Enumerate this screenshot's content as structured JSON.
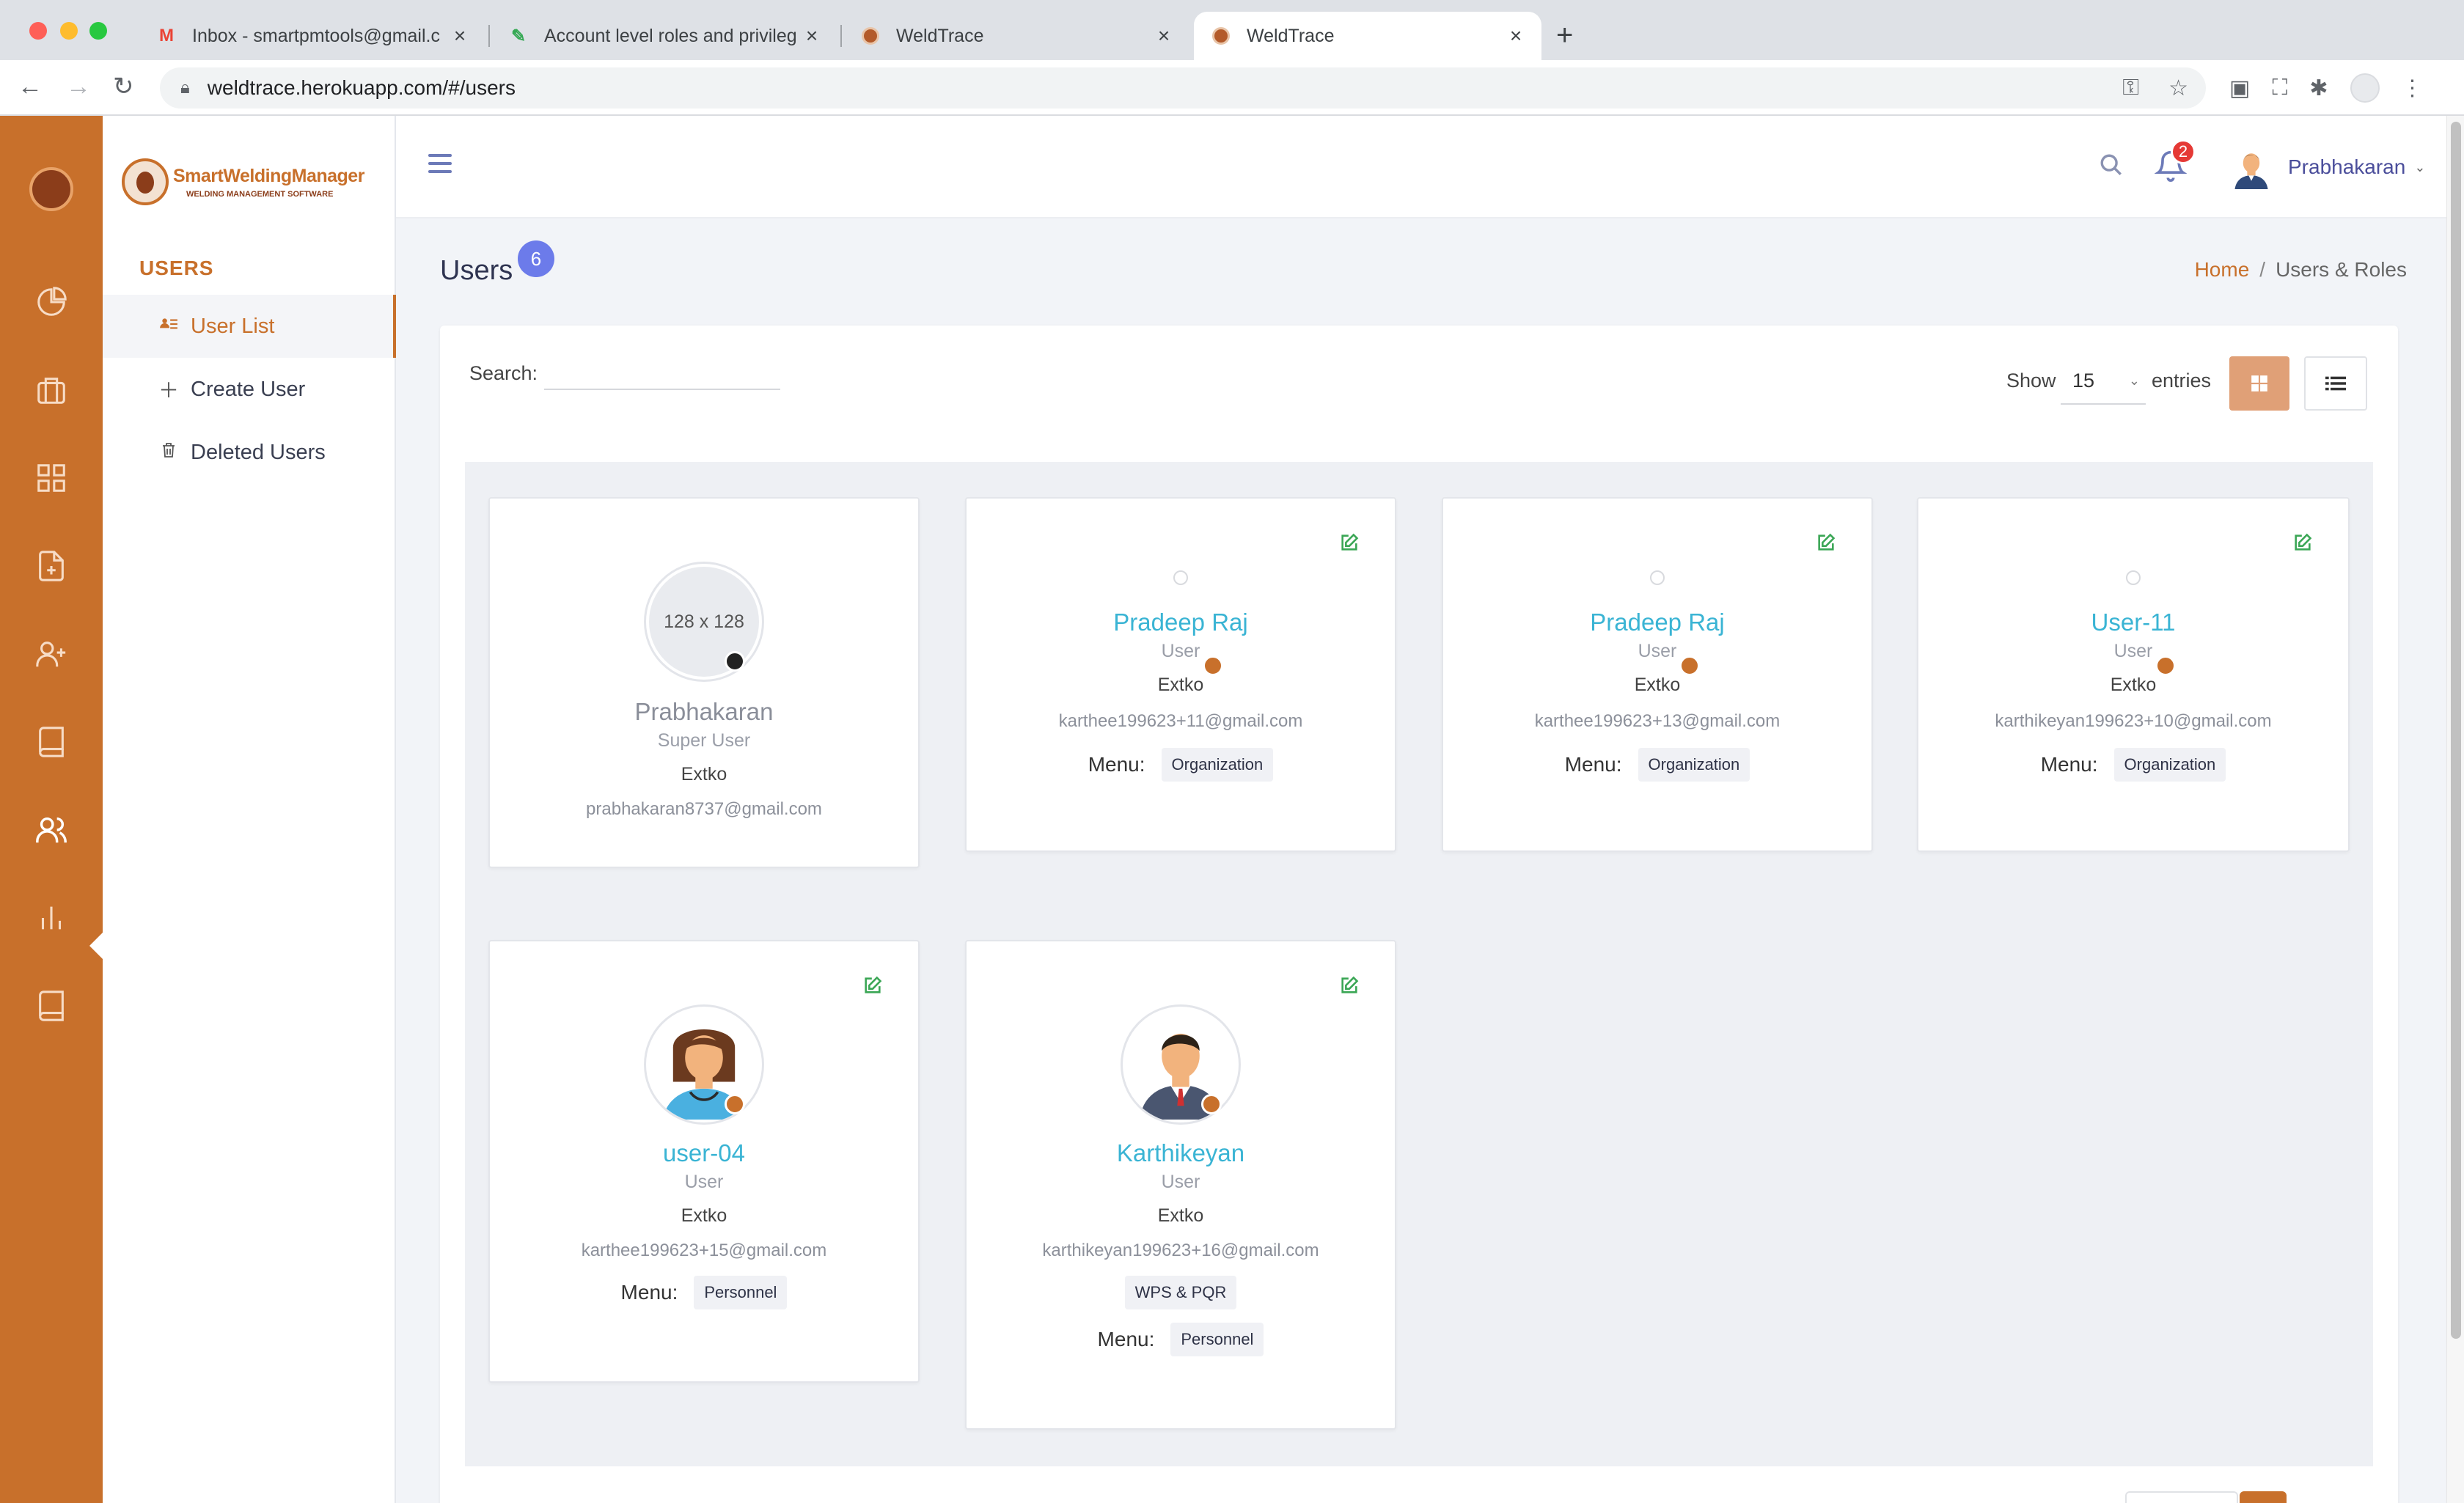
{
  "browser": {
    "tabs": [
      {
        "title": "Inbox - smartpmtools@gmail.c",
        "favicon": "gmail-icon",
        "active": false
      },
      {
        "title": "Account level roles and privileg",
        "favicon": "doc-icon",
        "active": false
      },
      {
        "title": "WeldTrace",
        "favicon": "weldtrace-icon",
        "active": false
      },
      {
        "title": "WeldTrace",
        "favicon": "weldtrace-icon",
        "active": true
      }
    ],
    "url": "weldtrace.herokuapp.com/#/users"
  },
  "brand": {
    "name": "SmartWeldingManager",
    "tagline": "WELDING MANAGEMENT SOFTWARE",
    "accent": "#c8702b"
  },
  "rail": {
    "icons": [
      "pie-chart-icon",
      "briefcase-icon",
      "grid-icon",
      "file-plus-icon",
      "user-plus-icon",
      "book-icon",
      "users-icon",
      "bar-chart-icon",
      "book-alt-icon"
    ],
    "active": "users-icon"
  },
  "sidebar": {
    "heading": "USERS",
    "items": [
      {
        "label": "User List",
        "icon": "user-list-icon",
        "active": true
      },
      {
        "label": "Create User",
        "icon": "plus-icon",
        "active": false
      },
      {
        "label": "Deleted Users",
        "icon": "trash-icon",
        "active": false
      }
    ]
  },
  "header": {
    "notification_count": "2",
    "user_name": "Prabhakaran"
  },
  "page": {
    "title": "Users",
    "count": "6",
    "breadcrumb": {
      "home": "Home",
      "separator": "/",
      "current": "Users & Roles"
    }
  },
  "toolbar": {
    "search_label": "Search:",
    "search_value": "",
    "show_label": "Show",
    "page_size": "15",
    "entries_label": "entries"
  },
  "users": [
    {
      "name": "Prabhakaran",
      "role": "Super User",
      "org": "Extko",
      "email": "prabhakaran8737@gmail.com",
      "avatar": "placeholder",
      "placeholder_text": "128 x 128",
      "status_color": "#222222",
      "menus": []
    },
    {
      "name": "Pradeep Raj",
      "role": "User",
      "org": "Extko",
      "email": "karthee199623+11@gmail.com",
      "avatar": "none",
      "status_color": "#c8702b",
      "menu_label": "Menu:",
      "menus": [
        "Organization"
      ]
    },
    {
      "name": "Pradeep Raj",
      "role": "User",
      "org": "Extko",
      "email": "karthee199623+13@gmail.com",
      "avatar": "none",
      "status_color": "#c8702b",
      "menu_label": "Menu:",
      "menus": [
        "Organization"
      ]
    },
    {
      "name": "User-11",
      "role": "User",
      "org": "Extko",
      "email": "karthikeyan199623+10@gmail.com",
      "avatar": "none",
      "status_color": "#c8702b",
      "menu_label": "Menu:",
      "menus": [
        "Organization"
      ]
    },
    {
      "name": "user-04",
      "role": "User",
      "org": "Extko",
      "email": "karthee199623+15@gmail.com",
      "avatar": "female",
      "status_color": "#c8702b",
      "menu_label": "Menu:",
      "menus": [
        "Personnel"
      ]
    },
    {
      "name": "Karthikeyan",
      "role": "User",
      "org": "Extko",
      "email": "karthikeyan199623+16@gmail.com",
      "avatar": "male",
      "status_color": "#c8702b",
      "menu_label": "Menu:",
      "menus": [
        "WPS & PQR",
        "Personnel"
      ]
    }
  ]
}
